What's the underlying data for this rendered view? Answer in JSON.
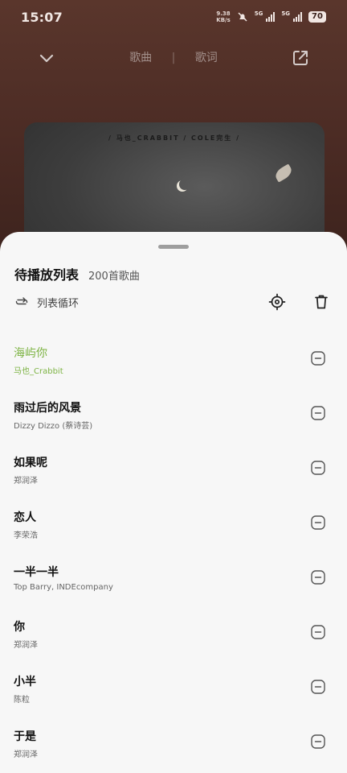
{
  "status_bar": {
    "time": "15:07",
    "net_speed_value": "9.38",
    "net_speed_unit": "KB/s",
    "sig1_label": "5G",
    "sig2_label": "5G",
    "battery": "70"
  },
  "nav": {
    "tab_song": "歌曲",
    "separator": "|",
    "tab_lyrics": "歌词"
  },
  "album": {
    "credit_text": "/ 马也_CRABBIT / COLE完生 /"
  },
  "playlist": {
    "title": "待播放列表",
    "count": "200首歌曲",
    "mode_label": "列表循环",
    "songs": [
      {
        "title": "海屿你",
        "artist": "马也_Crabbit"
      },
      {
        "title": "雨过后的风景",
        "artist": "Dizzy Dizzo (蔡诗芸)"
      },
      {
        "title": "如果呢",
        "artist": "郑润泽"
      },
      {
        "title": "恋人",
        "artist": "李荣浩"
      },
      {
        "title": "一半一半",
        "artist": "Top Barry, INDEcompany"
      },
      {
        "title": "你",
        "artist": "郑润泽"
      },
      {
        "title": "小半",
        "artist": "陈粒"
      },
      {
        "title": "于是",
        "artist": "郑润泽"
      }
    ]
  },
  "colors": {
    "active_song": "#7cb342",
    "sheet_bg": "#f7f7f7",
    "player_bg": "#4b2b24"
  }
}
